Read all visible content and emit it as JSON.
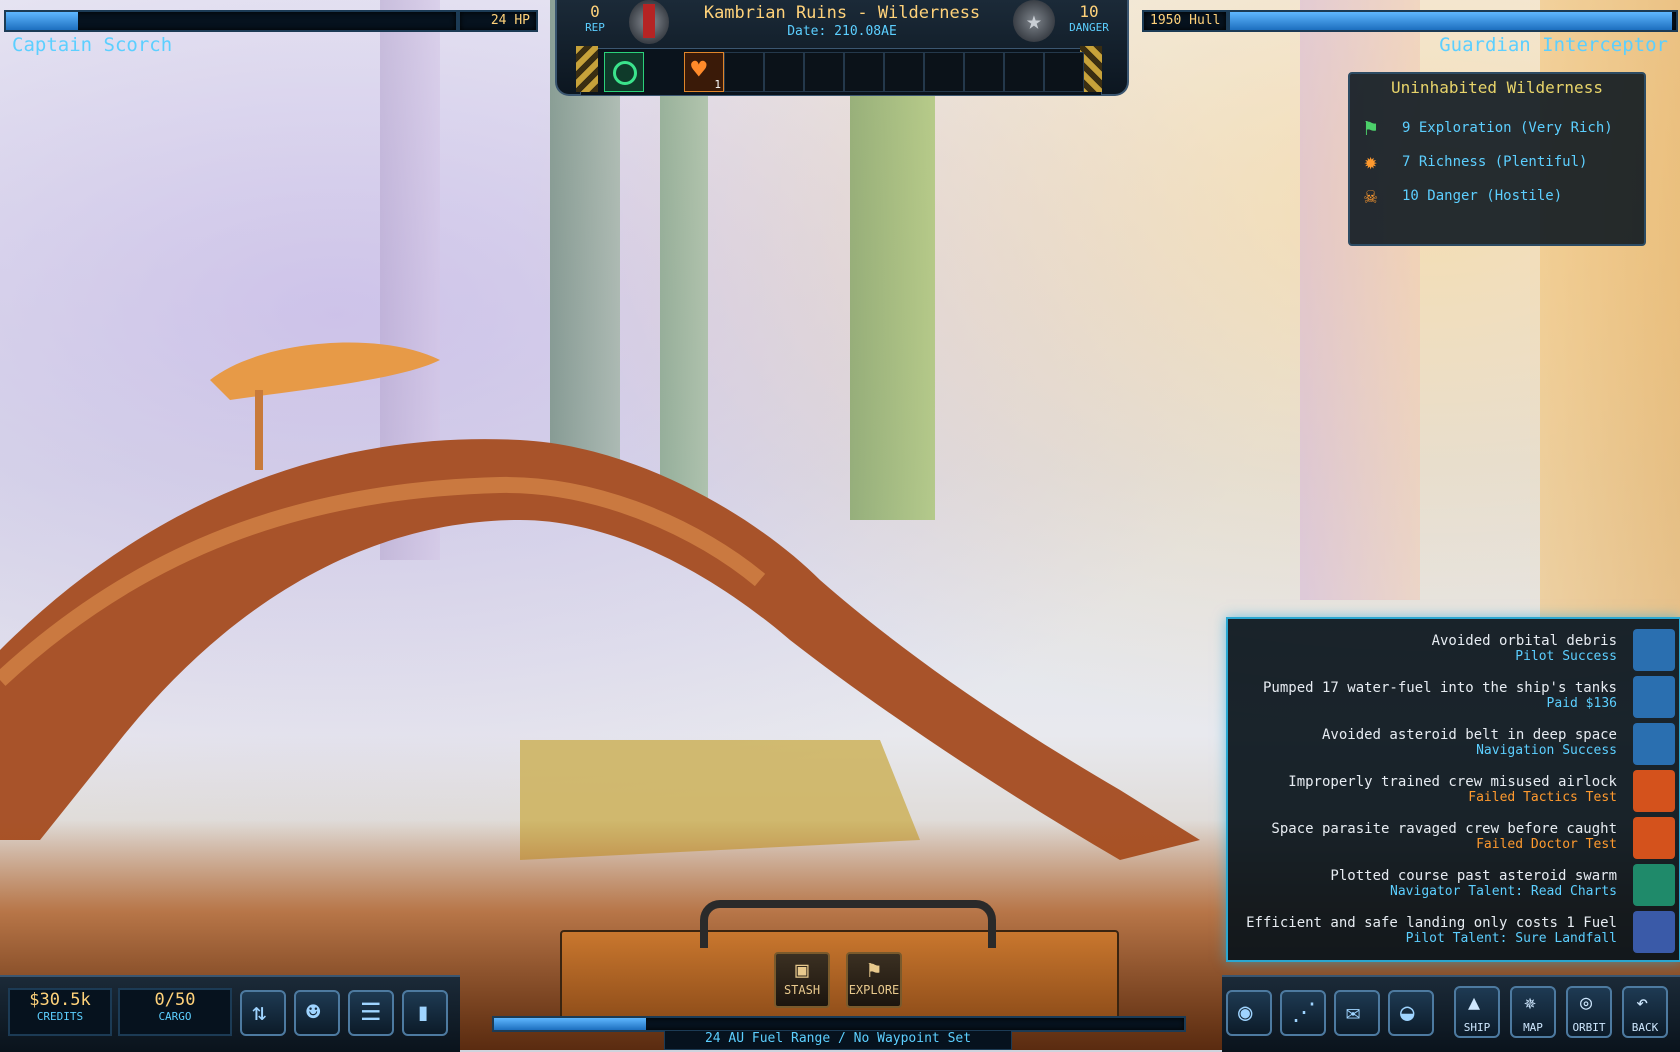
{
  "player": {
    "name": "Captain Scorch",
    "hp": "24 HP",
    "hp_fraction": 0.16
  },
  "ship": {
    "name": "Guardian Interceptor",
    "hull": "1950 Hull",
    "hull_fraction": 0.99
  },
  "location": {
    "title": "Kambrian Ruins - Wilderness",
    "date": "Date: 210.08AE"
  },
  "rep": {
    "value": "0",
    "label": "REP"
  },
  "danger": {
    "value": "10",
    "label": "DANGER"
  },
  "status_slots": {
    "effect_count": "1"
  },
  "planet_info": {
    "title": "Uninhabited Wilderness",
    "items": [
      {
        "text": "9 Exploration (Very Rich)",
        "icon": "exploration-flag-icon"
      },
      {
        "text": "7 Richness (Plentiful)",
        "icon": "richness-fire-icon"
      },
      {
        "text": "10 Danger (Hostile)",
        "icon": "danger-skull-icon"
      }
    ]
  },
  "log": [
    {
      "title": "Avoided orbital debris",
      "sub": "Pilot Success",
      "sub_color": "#5ccfff",
      "icon": "pilot-wings-icon",
      "icon_color": "#2a6fb0"
    },
    {
      "title": "Pumped 17 water-fuel into the ship's tanks",
      "sub": "Paid $136",
      "sub_color": "#5ccfff",
      "icon": "fuel-icon",
      "icon_color": "#2a6fb0"
    },
    {
      "title": "Avoided asteroid belt in deep space",
      "sub": "Navigation Success",
      "sub_color": "#5ccfff",
      "icon": "navigation-icon",
      "icon_color": "#2a6fb0"
    },
    {
      "title": "Improperly trained crew misused airlock",
      "sub": "Failed Tactics Test",
      "sub_color": "#ff9a2e",
      "icon": "tactics-icon",
      "icon_color": "#d4521c"
    },
    {
      "title": "Space parasite ravaged crew before caught",
      "sub": "Failed Doctor Test",
      "sub_color": "#ff9a2e",
      "icon": "doctor-cross-icon",
      "icon_color": "#d4521c"
    },
    {
      "title": "Plotted course past asteroid swarm",
      "sub": "Navigator Talent: Read Charts",
      "sub_color": "#5ccfff",
      "icon": "read-charts-icon",
      "icon_color": "#1f8a6a"
    },
    {
      "title": "Efficient and safe landing only costs 1 Fuel",
      "sub": "Pilot Talent: Sure Landfall",
      "sub_color": "#5ccfff",
      "icon": "sure-landfall-icon",
      "icon_color": "#3a5aa8"
    }
  ],
  "credits": {
    "value": "$30.5k",
    "label": "CREDITS"
  },
  "cargo": {
    "value": "0/50",
    "label": "CARGO"
  },
  "center_buttons": {
    "stash": "STASH",
    "explore": "EXPLORE"
  },
  "fuel": {
    "text": "24 AU Fuel Range / No Waypoint Set"
  },
  "nav_buttons": {
    "ship": "SHIP",
    "map": "MAP",
    "orbit": "ORBIT",
    "back": "BACK"
  }
}
